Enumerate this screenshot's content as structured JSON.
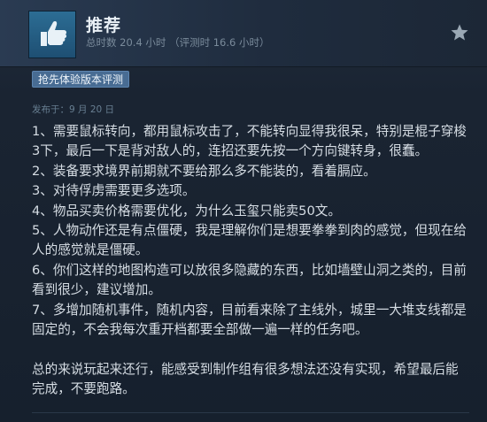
{
  "review": {
    "verdict": "推荐",
    "hours_total": "总时数 20.4 小时",
    "hours_at_review": "（评测时 16.6 小时）",
    "early_access_badge": "抢先体验版本评测",
    "posted": "发布于：9 月 20 日",
    "body": "1、需要鼠标转向，都用鼠标攻击了，不能转向显得我很呆，特别是棍子穿梭3下，最后一下是背对敌人的，连招还要先按一个方向键转身，很蠢。\n2、装备要求境界前期就不要给那么多不能装的，看着膈应。\n3、对待俘虏需要更多选项。\n4、物品买卖价格需要优化，为什么玉玺只能卖50文。\n5、人物动作还是有点僵硬，我是理解你们是想要拳拳到肉的感觉，但现在给人的感觉就是僵硬。\n6、你们这样的地图构造可以放很多隐藏的东西，比如墙壁山洞之类的，目前看到很少，建议增加。\n7、多增加随机事件，随机内容，目前看来除了主线外，城里一大堆支线都是固定的，不会我每次重开档都要全部做一遍一样的任务吧。\n\n总的来说玩起来还行，能感受到制作组有很多想法还没有实现，希望最后能完成，不要跑路。"
  },
  "icons": {
    "thumb": "thumbs-up-icon",
    "award": "star-icon"
  },
  "colors": {
    "thumb_bg": "#2c6d94",
    "badge_bg": "#486c93",
    "text": "#d6dde4",
    "muted": "#7a8b9b"
  }
}
